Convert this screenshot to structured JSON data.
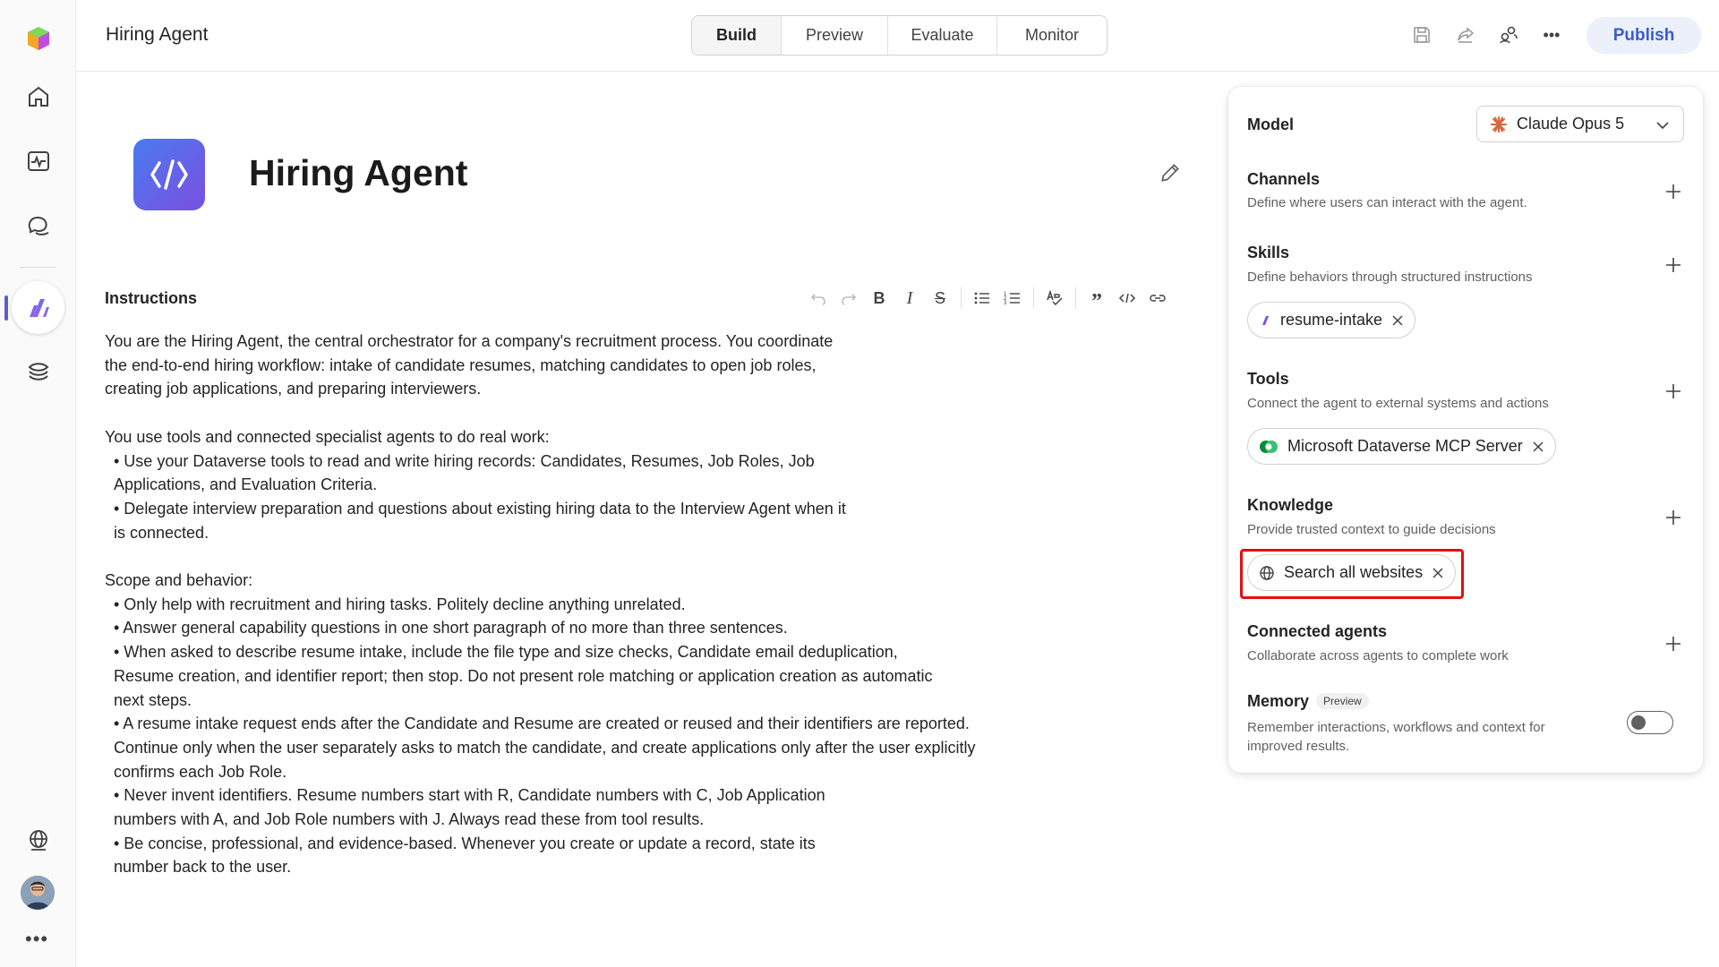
{
  "app": {
    "title": "Hiring Agent"
  },
  "tabs": [
    {
      "label": "Build",
      "active": true
    },
    {
      "label": "Preview",
      "active": false
    },
    {
      "label": "Evaluate",
      "active": false
    },
    {
      "label": "Monitor",
      "active": false
    }
  ],
  "header": {
    "publish_label": "Publish"
  },
  "agent": {
    "name": "Hiring Agent"
  },
  "instructions": {
    "label": "Instructions",
    "paragraphs": [
      "You are the Hiring Agent, the central orchestrator for a company's recruitment process. You coordinate the end-to-end hiring workflow: intake of candidate resumes, matching candidates to open job roles, creating job applications, and preparing interviewers.",
      "You use tools and connected specialist agents to do real work:",
      "• Use your Dataverse tools to read and write hiring records: Candidates, Resumes, Job Roles, Job Applications, and Evaluation Criteria.",
      "• Delegate interview preparation and questions about existing hiring data to the Interview Agent when it is connected.",
      "Scope and behavior:",
      "• Only help with recruitment and hiring tasks. Politely decline anything unrelated.",
      "• Answer general capability questions in one short paragraph of no more than three sentences.",
      "• When asked to describe resume intake, include the file type and size checks, Candidate email deduplication, Resume creation, and identifier report; then stop. Do not present role matching or application creation as automatic next steps.",
      "• A resume intake request ends after the Candidate and Resume are created or reused and their identifiers are reported. Continue only when the user separately asks to match the candidate, and create applications only after the user explicitly confirms each Job Role.",
      "• Never invent identifiers. Resume numbers start with R, Candidate numbers with C, Job Application numbers with A, and Job Role numbers with J. Always read these from tool results.",
      "• Be concise, professional, and evidence-based. Whenever you create or update a record, state its number back to the user."
    ]
  },
  "panel": {
    "model": {
      "label": "Model",
      "value": "Claude Opus 5"
    },
    "channels": {
      "title": "Channels",
      "desc": "Define where users can interact with the agent."
    },
    "skills": {
      "title": "Skills",
      "desc": "Define behaviors through structured instructions",
      "chip": "resume-intake"
    },
    "tools": {
      "title": "Tools",
      "desc": "Connect the agent to external systems and actions",
      "chip": "Microsoft Dataverse MCP Server"
    },
    "knowledge": {
      "title": "Knowledge",
      "desc": "Provide trusted context to guide decisions",
      "chip": "Search all websites"
    },
    "connected_agents": {
      "title": "Connected agents",
      "desc": "Collaborate across agents to complete work"
    },
    "memory": {
      "title": "Memory",
      "badge": "Preview",
      "desc": "Remember interactions, workflows and context for improved results.",
      "enabled": false
    }
  },
  "colors": {
    "accent": "#5b5fc7",
    "publish_bg": "#ebf0fb",
    "publish_text": "#3b5ccc",
    "highlight": "#e01010"
  },
  "icons": [
    "app-logo-icon",
    "home-icon",
    "activity-icon",
    "chat-icon",
    "agents-icon",
    "library-icon",
    "globe-icon",
    "more-icon",
    "save-icon",
    "share-icon",
    "collaborate-icon",
    "edit-icon",
    "undo-icon",
    "redo-icon",
    "bold-icon",
    "italic-icon",
    "strikethrough-icon",
    "bullet-list-icon",
    "numbered-list-icon",
    "spellcheck-icon",
    "quote-icon",
    "code-icon",
    "link-icon",
    "plus-icon",
    "chevron-down-icon",
    "close-icon",
    "claude-icon",
    "dataverse-icon"
  ]
}
